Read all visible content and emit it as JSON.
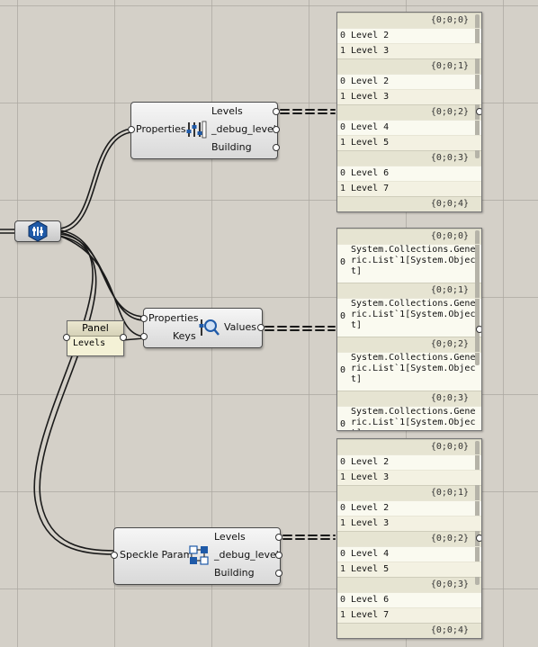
{
  "canvas": {
    "background": "#d4d0c8"
  },
  "components": {
    "properties_top": {
      "inputs": [
        "Properties"
      ],
      "outputs": [
        "Levels",
        "_debug_level",
        "Building"
      ],
      "icon": "speckle-properties-icon"
    },
    "source_hub": {
      "icon": "speckle-hub-icon"
    },
    "panel_small": {
      "title": "Panel",
      "content": "Levels"
    },
    "value_by_key": {
      "inputs": [
        "Properties",
        "Keys"
      ],
      "outputs": [
        "Values"
      ],
      "icon": "search-key-icon"
    },
    "speckle_param": {
      "inputs": [
        "Speckle Param"
      ],
      "outputs": [
        "Levels",
        "_debug_level",
        "Building"
      ],
      "icon": "speckle-param-icon"
    }
  },
  "panels": {
    "top": {
      "branches": [
        {
          "path": "{0;0;0}",
          "items": [
            {
              "i": "0",
              "v": "Level 2"
            },
            {
              "i": "1",
              "v": "Level 3"
            }
          ]
        },
        {
          "path": "{0;0;1}",
          "items": [
            {
              "i": "0",
              "v": "Level 2"
            },
            {
              "i": "1",
              "v": "Level 3"
            }
          ]
        },
        {
          "path": "{0;0;2}",
          "items": [
            {
              "i": "0",
              "v": "Level 4"
            },
            {
              "i": "1",
              "v": "Level 5"
            }
          ]
        },
        {
          "path": "{0;0;3}",
          "items": [
            {
              "i": "0",
              "v": "Level 6"
            },
            {
              "i": "1",
              "v": "Level 7"
            }
          ]
        },
        {
          "path": "{0;0;4}",
          "items": []
        }
      ]
    },
    "middle": {
      "branches": [
        {
          "path": "{0;0;0}",
          "items": [
            {
              "i": "0",
              "v": "System.Collections.Generic.List`1[System.Object]"
            }
          ]
        },
        {
          "path": "{0;0;1}",
          "items": [
            {
              "i": "0",
              "v": "System.Collections.Generic.List`1[System.Object]"
            }
          ]
        },
        {
          "path": "{0;0;2}",
          "items": [
            {
              "i": "0",
              "v": "System.Collections.Generic.List`1[System.Object]"
            }
          ]
        },
        {
          "path": "{0;0;3}",
          "items": [
            {
              "i": "0",
              "v": "System.Collections.Generic.List`1[System.Object]"
            }
          ]
        }
      ]
    },
    "bottom": {
      "branches": [
        {
          "path": "{0;0;0}",
          "items": [
            {
              "i": "0",
              "v": "Level 2"
            },
            {
              "i": "1",
              "v": "Level 3"
            }
          ]
        },
        {
          "path": "{0;0;1}",
          "items": [
            {
              "i": "0",
              "v": "Level 2"
            },
            {
              "i": "1",
              "v": "Level 3"
            }
          ]
        },
        {
          "path": "{0;0;2}",
          "items": [
            {
              "i": "0",
              "v": "Level 4"
            },
            {
              "i": "1",
              "v": "Level 5"
            }
          ]
        },
        {
          "path": "{0;0;3}",
          "items": [
            {
              "i": "0",
              "v": "Level 6"
            },
            {
              "i": "1",
              "v": "Level 7"
            }
          ]
        },
        {
          "path": "{0;0;4}",
          "items": []
        }
      ]
    }
  }
}
